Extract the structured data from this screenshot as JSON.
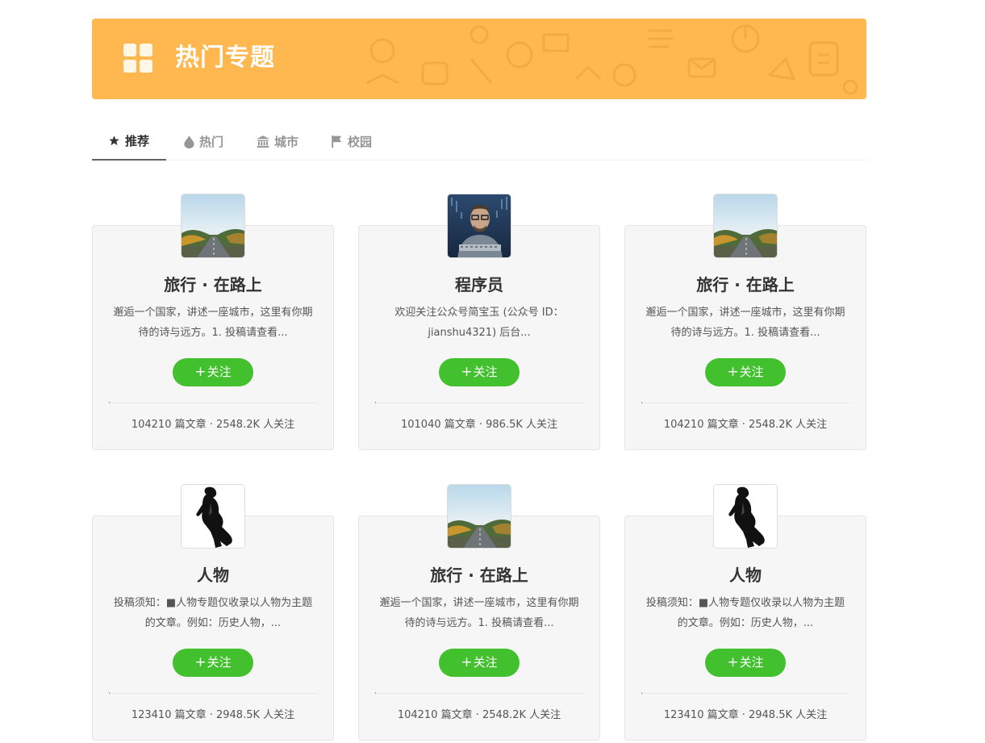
{
  "banner": {
    "title": "热门专题",
    "color": "#ffb850"
  },
  "tabs": [
    {
      "label": "推荐",
      "icon": "star-icon",
      "active": true
    },
    {
      "label": "热门",
      "icon": "fire-icon",
      "active": false
    },
    {
      "label": "城市",
      "icon": "bank-icon",
      "active": false
    },
    {
      "label": "校园",
      "icon": "flag-icon",
      "active": false
    }
  ],
  "follow_label": "关注",
  "collections": [
    {
      "title": "旅行 · 在路上",
      "avatar": "road-landscape-image",
      "desc": "邂逅一个国家，讲述一座城市，这里有你期待的诗与远方。1. 投稿请查看...",
      "stats": "104210 篇文章 · 2548.2K 人关注"
    },
    {
      "title": "程序员",
      "avatar": "programmer-portrait-image",
      "desc": "欢迎关注公众号简宝玉 (公众号 ID：jianshu4321) 后台...",
      "stats": "101040 篇文章 · 986.5K 人关注"
    },
    {
      "title": "旅行 · 在路上",
      "avatar": "road-landscape-image",
      "desc": "邂逅一个国家，讲述一座城市，这里有你期待的诗与远方。1. 投稿请查看...",
      "stats": "104210 篇文章 · 2548.2K 人关注"
    },
    {
      "title": "人物",
      "avatar": "dancer-silhouette-image",
      "desc": "投稿须知：■人物专题仅收录以人物为主题的文章。例如：历史人物，...",
      "stats": "123410 篇文章 · 2948.5K 人关注"
    },
    {
      "title": "旅行 · 在路上",
      "avatar": "road-landscape-image",
      "desc": "邂逅一个国家，讲述一座城市，这里有你期待的诗与远方。1. 投稿请查看...",
      "stats": "104210 篇文章 · 2548.2K 人关注"
    },
    {
      "title": "人物",
      "avatar": "dancer-silhouette-image",
      "desc": "投稿须知：■人物专题仅收录以人物为主题的文章。例如：历史人物，...",
      "stats": "123410 篇文章 · 2948.5K 人关注"
    }
  ],
  "colors": {
    "follow_button": "#42c02e",
    "card_bg": "#f6f6f6",
    "active_tab": "#333333",
    "inactive_tab": "#969696"
  }
}
